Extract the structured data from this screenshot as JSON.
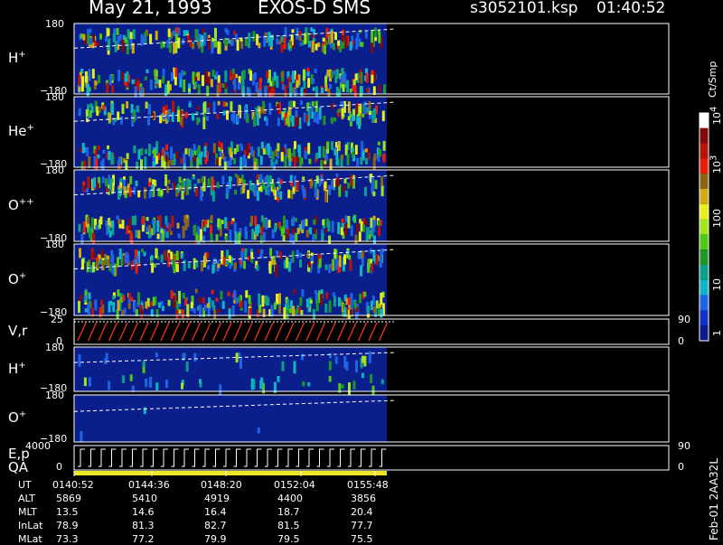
{
  "header": {
    "date": "May 21, 1993",
    "mission": "EXOS-D SMS",
    "file": "s3052101.ksp",
    "time": "01:40:52"
  },
  "panels": [
    {
      "label": "H",
      "sup": "+",
      "ytop": "180",
      "ybot": "−180"
    },
    {
      "label": "He",
      "sup": "+",
      "ytop": "180",
      "ybot": "−180"
    },
    {
      "label": "O",
      "sup": "++",
      "ytop": "180",
      "ybot": "−180"
    },
    {
      "label": "O",
      "sup": "+",
      "ytop": "180",
      "ybot": "−180"
    },
    {
      "label": "V,r",
      "sup": "",
      "ytop": "25",
      "ybot": "0",
      "rtop": "90",
      "rbot": "0"
    },
    {
      "label": "H",
      "sup": "+",
      "ytop": "180",
      "ybot": "−180"
    },
    {
      "label": "O",
      "sup": "+",
      "ytop": "180",
      "ybot": "−180"
    },
    {
      "label": "E,p",
      "sup": "",
      "label2": "QA",
      "ytop": "4000",
      "ybot": "0",
      "rtop": "90",
      "rbot": "0"
    }
  ],
  "colorbar": {
    "unit": "Ct/Smp",
    "labels": [
      "1",
      "10",
      "100",
      "10",
      "10"
    ],
    "exps": [
      "",
      "",
      "",
      "3",
      "4"
    ],
    "colors": [
      "#0a1c8c",
      "#1030c8",
      "#1e64e6",
      "#10b4c8",
      "#0aa08c",
      "#1e9628",
      "#50c814",
      "#a0e61e",
      "#e6f01e",
      "#d2aa14",
      "#8c6414",
      "#e61e0a",
      "#b4140a",
      "#820a0a",
      "#ffffff"
    ]
  },
  "ephemeris": {
    "rows": [
      "UT",
      "ALT",
      "MLT",
      "InLat",
      "MLat"
    ],
    "columns": [
      {
        "UT": "0140:52",
        "ALT": "5869",
        "MLT": "13.5",
        "InLat": "78.9",
        "MLat": "73.3"
      },
      {
        "UT": "0144:36",
        "ALT": "5410",
        "MLT": "14.6",
        "InLat": "81.3",
        "MLat": "77.2"
      },
      {
        "UT": "0148:20",
        "ALT": "4919",
        "MLT": "16.4",
        "InLat": "82.7",
        "MLat": "79.9"
      },
      {
        "UT": "0152:04",
        "ALT": "4400",
        "MLT": "18.7",
        "InLat": "81.5",
        "MLat": "79.5"
      },
      {
        "UT": "0155:48",
        "ALT": "3856",
        "MLT": "20.4",
        "InLat": "77.7",
        "MLat": "75.5"
      }
    ]
  },
  "footer": {
    "stamp": "Feb-01 2AA32L"
  },
  "chart_data": {
    "type": "heatmap",
    "title": "May 21, 1993   EXOS-D SMS",
    "x": [
      "0140:52",
      "0144:36",
      "0148:20",
      "0152:04",
      "0155:48"
    ],
    "xlabel": "UT",
    "ylim": [
      -180,
      180
    ],
    "colorscale": "log",
    "colorbar_range": [
      1,
      10000
    ],
    "series": [
      {
        "name": "H+"
      },
      {
        "name": "He+"
      },
      {
        "name": "O++"
      },
      {
        "name": "O+"
      },
      {
        "name": "V,r"
      },
      {
        "name": "H+"
      },
      {
        "name": "O+"
      },
      {
        "name": "E,p"
      }
    ],
    "data_ends_at": "0157:15"
  }
}
